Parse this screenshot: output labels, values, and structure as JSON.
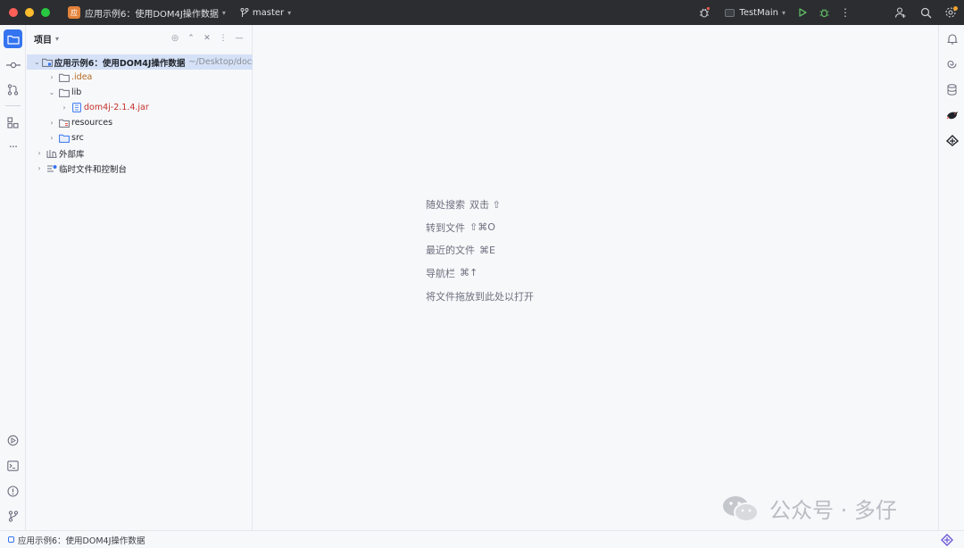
{
  "titlebar": {
    "project_badge": "应",
    "project_name": "应用示例6：使用DOM4J操作数据",
    "branch": "master",
    "run_config": "TestMain"
  },
  "left_strip": {
    "icons": [
      "folder-icon",
      "commit-icon",
      "pull-request-icon",
      "structure-icon",
      "more-icon",
      "run-icon",
      "terminal-icon",
      "problems-icon",
      "git-icon"
    ]
  },
  "project_panel": {
    "title": "项目",
    "tree": [
      {
        "label": "应用示例6：使用DOM4J操作数据",
        "hint": "~/Desktop/docs/",
        "level": 0,
        "expanded": true,
        "icon": "module-folder-icon",
        "selected": true
      },
      {
        "label": ".idea",
        "level": 1,
        "expanded": false,
        "icon": "folder-icon",
        "color": "orange"
      },
      {
        "label": "lib",
        "level": 1,
        "expanded": true,
        "icon": "folder-icon"
      },
      {
        "label": "dom4j-2.1.4.jar",
        "level": 2,
        "expanded": false,
        "icon": "jar-icon",
        "color": "red"
      },
      {
        "label": "resources",
        "level": 1,
        "expanded": false,
        "icon": "resources-folder-icon"
      },
      {
        "label": "src",
        "level": 1,
        "expanded": false,
        "icon": "source-folder-icon"
      },
      {
        "label": "外部库",
        "level": 0,
        "expanded": false,
        "icon": "library-icon"
      },
      {
        "label": "临时文件和控制台",
        "level": 0,
        "expanded": false,
        "icon": "scratch-icon"
      }
    ]
  },
  "editor": {
    "hints": [
      {
        "text": "随处搜索",
        "key": "双击 ⇧"
      },
      {
        "text": "转到文件",
        "key": "⇧⌘O"
      },
      {
        "text": "最近的文件",
        "key": "⌘E"
      },
      {
        "text": "导航栏",
        "key": "⌘↑"
      },
      {
        "text": "将文件拖放到此处以打开",
        "key": ""
      }
    ]
  },
  "statusbar": {
    "path": "应用示例6：使用DOM4J操作数据"
  },
  "watermark": {
    "text": "公众号 · 多仔"
  }
}
